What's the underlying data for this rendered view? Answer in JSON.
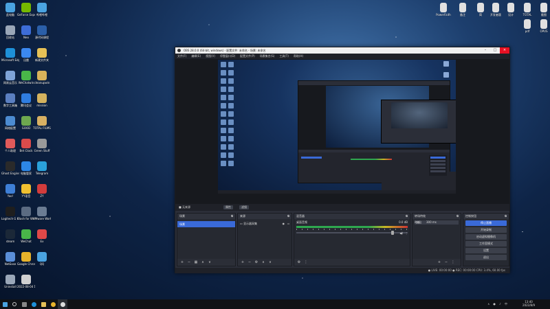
{
  "desktop": {
    "icons": [
      {
        "label": "此电脑",
        "color": "#4aa3e0"
      },
      {
        "label": "GeForce Experience",
        "color": "#76b900"
      },
      {
        "label": "哔哩哔哩",
        "color": "#4aa3e0"
      },
      {
        "label": "回收站",
        "color": "#9aa7b8"
      },
      {
        "label": "Neo",
        "color": "#3d6dd8"
      },
      {
        "label": "源代码课程",
        "color": "#2b5fa8"
      },
      {
        "label": "Microsoft Edge",
        "color": "#1e90d8"
      },
      {
        "label": "迅雷",
        "color": "#3b88f0"
      },
      {
        "label": "新建文件夹",
        "color": "#e7c156"
      },
      {
        "label": "网易云音乐",
        "color": "#7ea2d6"
      },
      {
        "label": "WeChatwin",
        "color": "#49b649"
      },
      {
        "label": "cleanupwin",
        "color": "#d9b35a"
      },
      {
        "label": "数字工具箱",
        "color": "#5b7fc0"
      },
      {
        "label": "腾讯会议",
        "color": "#2f7de1"
      },
      {
        "label": "mission",
        "color": "#d4b25e"
      },
      {
        "label": "网络配置",
        "color": "#4c8bd1"
      },
      {
        "label": "GOOD",
        "color": "#6ea84f"
      },
      {
        "label": "TOTAL FILMS",
        "color": "#d8b063"
      },
      {
        "label": "个人助理",
        "color": "#e05a5a"
      },
      {
        "label": "Bet Clock",
        "color": "#d94b4b"
      },
      {
        "label": "Green Stuff",
        "color": "#9a9a9a"
      },
      {
        "label": "Ghost Engine",
        "color": "#2a2a2a"
      },
      {
        "label": "电脑管家",
        "color": "#2d87e6"
      },
      {
        "label": "Telegram",
        "color": "#2aa1da"
      },
      {
        "label": "Yoo!",
        "color": "#3e7fd6"
      },
      {
        "label": "YY语音",
        "color": "#f0c030"
      },
      {
        "label": "ZY",
        "color": "#d23c3c"
      },
      {
        "label": "Logitech G HUB",
        "color": "#1e1e1e"
      },
      {
        "label": "Clash for Windows",
        "color": "#5b6b82"
      },
      {
        "label": "VMware Workstation",
        "color": "#6b7c93"
      },
      {
        "label": "steam",
        "color": "#1b2838"
      },
      {
        "label": "WeChat",
        "color": "#49b649"
      },
      {
        "label": "Ex",
        "color": "#e04848"
      },
      {
        "label": "NetEase",
        "color": "#5a8fd8"
      },
      {
        "label": "Google Chrome",
        "color": "#e8b32b"
      },
      {
        "label": "QQ",
        "color": "#4aa3e0"
      },
      {
        "label": "Uninstall",
        "color": "#9aa7b8"
      },
      {
        "label": "2022-08-04 12-25-07",
        "color": "#d0d0d0"
      }
    ],
    "right_icons": [
      {
        "label": "PowerFaith",
        "color": "#e0e0e0"
      },
      {
        "label": "备注",
        "color": "#e0e0e0"
      },
      {
        "label": "简",
        "color": "#e0e0e0"
      },
      {
        "label": "开发者版",
        "color": "#e0e0e0"
      },
      {
        "label": "设计",
        "color": "#e0e0e0"
      },
      {
        "label": "TOTAL",
        "color": "#e0e0e0"
      },
      {
        "label": "截图",
        "color": "#e0e0e0"
      },
      {
        "label": "pdf",
        "color": "#e0e0e0"
      },
      {
        "label": "OPUS",
        "color": "#e0e0e0"
      }
    ]
  },
  "obs": {
    "title": "OBS 28.0.0 (64-bit, windows) - 配置文件: 未命名 - 场景: 未命名",
    "menu": [
      "文件(F)",
      "编辑(E)",
      "视图(V)",
      "停靠窗口(D)",
      "配置文件(P)",
      "场景集合(S)",
      "工具(T)",
      "帮助(H)"
    ],
    "control_bar": {
      "no_source": "■ 无来源",
      "properties": "属性",
      "filters": "滤镜"
    },
    "scenes": {
      "title": "场景",
      "items": [
        "场景"
      ]
    },
    "sources": {
      "title": "来源",
      "items": [
        "显示器采集"
      ]
    },
    "mixer": {
      "title": "混音器",
      "channel": "桌面音频",
      "level": "0.0 dB"
    },
    "transitions": {
      "title": "转场特效",
      "type": "淡出",
      "duration_label": "时长",
      "duration": "300 ms"
    },
    "controls": {
      "title": "控制按钮",
      "buttons": [
        "停止直播",
        "开始录制",
        "启动虚拟摄像机",
        "工作室模式",
        "设置",
        "退出"
      ]
    },
    "status": "● LIVE: 00:00:00   ● REC: 00:00:00   CPU: 3.4%, 60.00 fps"
  },
  "taskbar": {
    "time": "13:40",
    "date": "2022/8/9",
    "tray": "∧ ● ♪ 中"
  }
}
